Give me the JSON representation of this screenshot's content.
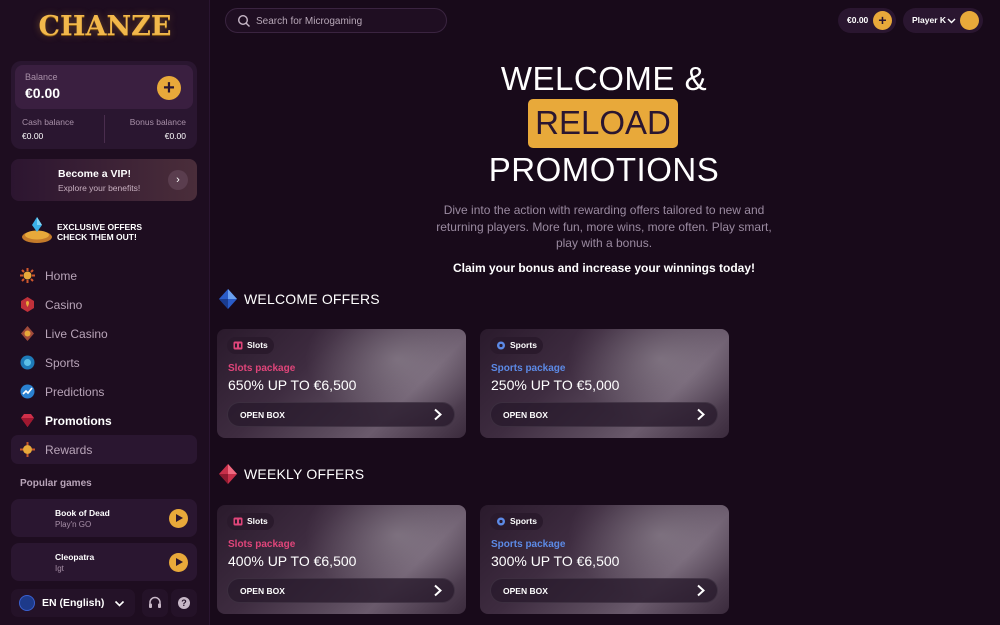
{
  "brand": {
    "logo_text": "CHANZE"
  },
  "sidebar": {
    "balance": {
      "label": "Balance",
      "value": "€0.00",
      "cash_label": "Cash balance",
      "cash_value": "€0.00",
      "bonus_label": "Bonus balance",
      "bonus_value": "€0.00"
    },
    "vip": {
      "title": "Become a VIP!",
      "subtitle": "Explore your benefits!"
    },
    "exclusive": {
      "line1": "EXCLUSIVE OFFERS",
      "line2": "CHECK THEM OUT!"
    },
    "nav": [
      {
        "label": "Home",
        "icon": "home-icon"
      },
      {
        "label": "Casino",
        "icon": "casino-icon"
      },
      {
        "label": "Live Casino",
        "icon": "live-casino-icon"
      },
      {
        "label": "Sports",
        "icon": "sports-icon"
      },
      {
        "label": "Predictions",
        "icon": "predictions-icon"
      },
      {
        "label": "Promotions",
        "icon": "promotions-icon",
        "active": true
      },
      {
        "label": "Rewards",
        "icon": "rewards-icon"
      }
    ],
    "popular_title": "Popular games",
    "popular_games": [
      {
        "name": "Book of Dead",
        "provider": "Play'n GO"
      },
      {
        "name": "Cleopatra",
        "provider": "Igt"
      }
    ],
    "language": "EN (English)"
  },
  "header": {
    "search_placeholder": "Search for Microgaming",
    "balance": "€0.00",
    "user_name": "Player K"
  },
  "hero": {
    "line1": "WELCOME &",
    "line2": "RELOAD",
    "line3": "PROMOTIONS",
    "description": "Dive into the action with rewarding offers tailored to new and returning players. More fun, more wins, more often. Play smart, play with a bonus.",
    "claim": "Claim your bonus and increase your winnings today!"
  },
  "sections": {
    "welcome": {
      "title": "WELCOME OFFERS",
      "offers": [
        {
          "badge": "Slots",
          "type": "Slots package",
          "amount": "650% UP TO €6,500",
          "button": "OPEN BOX"
        },
        {
          "badge": "Sports",
          "type": "Sports package",
          "amount": "250% UP TO €5,000",
          "button": "OPEN BOX"
        }
      ]
    },
    "weekly": {
      "title": "WEEKLY OFFERS",
      "offers": [
        {
          "badge": "Slots",
          "type": "Slots package",
          "amount": "400% UP TO €6,500",
          "button": "OPEN BOX"
        },
        {
          "badge": "Sports",
          "type": "Sports package",
          "amount": "300% UP TO €6,500",
          "button": "OPEN BOX"
        }
      ]
    }
  },
  "colors": {
    "accent": "#e8a93a",
    "background": "#180a1a",
    "sidebar": "#1e0d20",
    "slots": "#e0457a",
    "sports": "#5c8ae6"
  }
}
